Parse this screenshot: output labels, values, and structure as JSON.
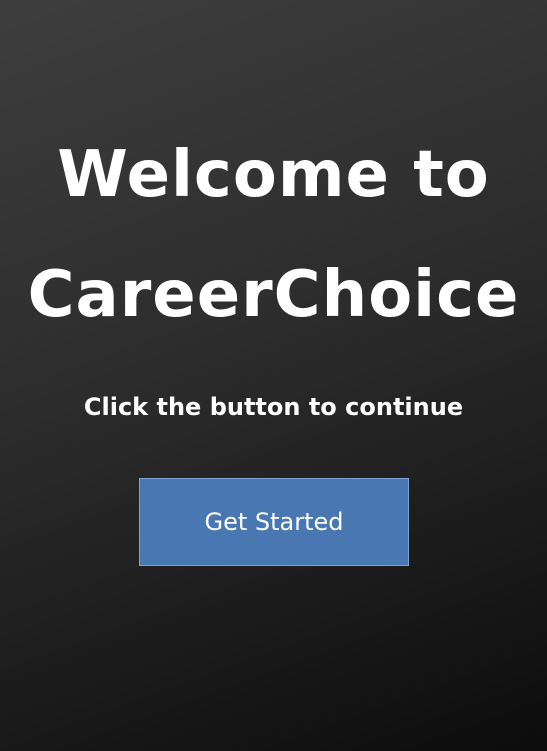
{
  "welcome": {
    "title_line1": "Welcome to",
    "title_line2": "CareerChoice",
    "subtitle": "Click the button to continue",
    "button_label": "Get Started"
  },
  "colors": {
    "background_top": "#3e3e3e",
    "background_bottom": "#0c0c0c",
    "button": "#4877b1",
    "text": "#ffffff"
  }
}
